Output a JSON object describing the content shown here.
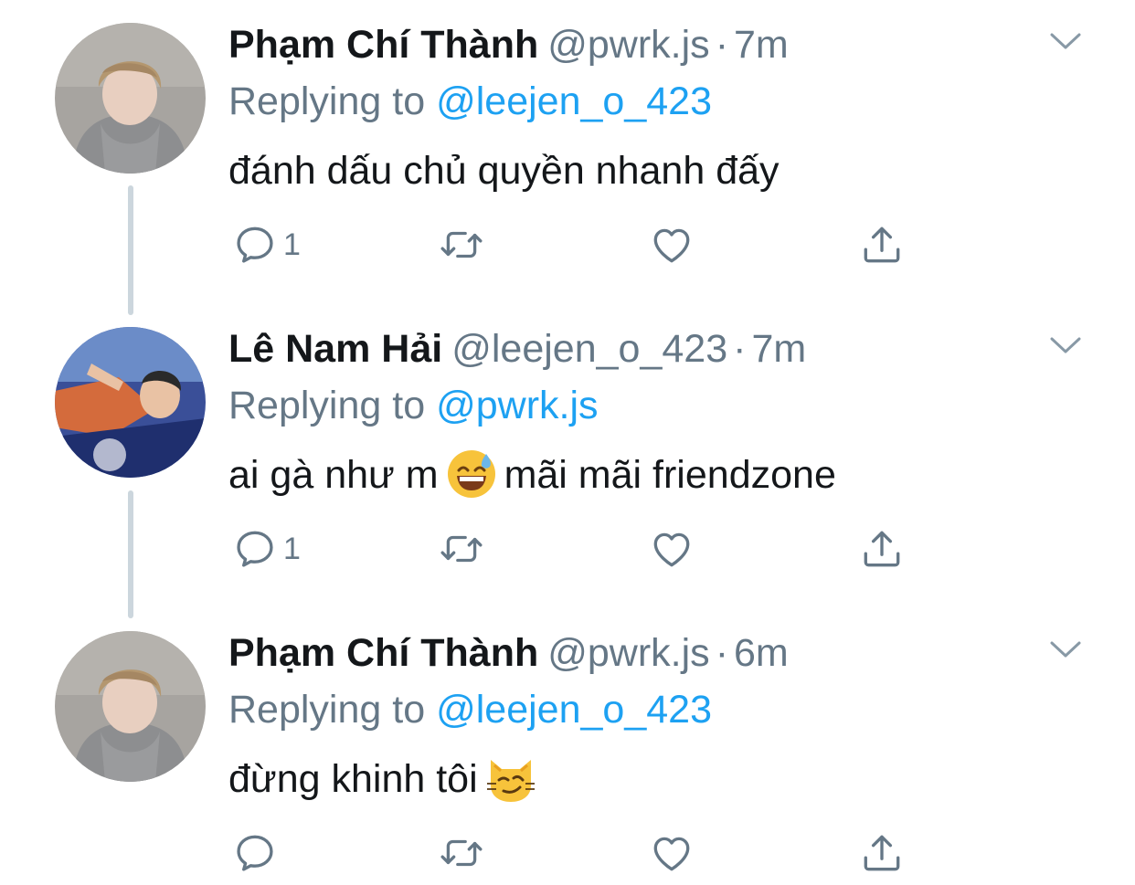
{
  "colors": {
    "text": "#14171a",
    "secondary": "#657786",
    "link": "#1da1f2",
    "thread_line": "#ccd6dd",
    "icon": "#657786"
  },
  "tweets": [
    {
      "name": "Phạm Chí Thành",
      "handle": "@pwrk.js",
      "separator": "·",
      "time": "7m",
      "replying_prefix": "Replying to",
      "replying_to": "@leejen_o_423",
      "text_before": "đánh dấu chủ quyền nhanh đấy",
      "emoji": "",
      "text_after": "",
      "reply_count": "1",
      "avatar_icon": "user-avatar-hoodie"
    },
    {
      "name": "Lê Nam Hải",
      "handle": "@leejen_o_423",
      "separator": "·",
      "time": "7m",
      "replying_prefix": "Replying to",
      "replying_to": "@pwrk.js",
      "text_before": "ai gà như m",
      "emoji": "grinning-face-with-sweat",
      "text_after": "mãi mãi friendzone",
      "reply_count": "1",
      "avatar_icon": "user-avatar-hockey"
    },
    {
      "name": "Phạm Chí Thành",
      "handle": "@pwrk.js",
      "separator": "·",
      "time": "6m",
      "replying_prefix": "Replying to",
      "replying_to": "@leejen_o_423",
      "text_before": "đừng khinh tôi",
      "emoji": "smirking-cat-face",
      "text_after": "",
      "reply_count": "",
      "avatar_icon": "user-avatar-hoodie"
    }
  ]
}
